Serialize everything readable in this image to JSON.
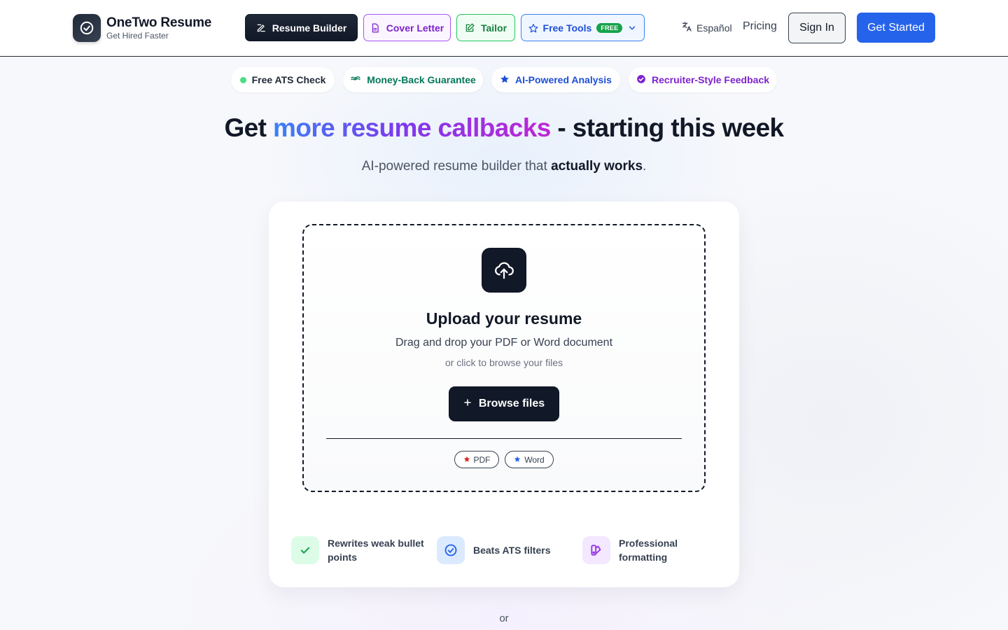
{
  "header": {
    "brand": "OneTwo Resume",
    "tagline": "Get Hired Faster",
    "nav": {
      "resume_builder": "Resume Builder",
      "cover_letter": "Cover Letter",
      "tailor": "Tailor",
      "free_tools": "Free Tools",
      "free_badge": "FREE"
    },
    "language": "Español",
    "pricing": "Pricing",
    "sign_in": "Sign In",
    "get_started": "Get Started"
  },
  "trust_pills": [
    {
      "label": "Free ATS Check",
      "icon": "green-dot-icon",
      "color": "#1f2937"
    },
    {
      "label": "Money-Back Guarantee",
      "icon": "cash-icon",
      "color": "#047857"
    },
    {
      "label": "AI-Powered Analysis",
      "icon": "star-icon",
      "color": "#1d4ed8"
    },
    {
      "label": "Recruiter-Style Feedback",
      "icon": "check-badge-icon",
      "color": "#7e22ce"
    }
  ],
  "hero": {
    "title_prefix": "Get ",
    "title_highlight": "more resume callbacks",
    "title_suffix": " - starting this week",
    "subtitle_prefix": "AI-powered resume builder that ",
    "subtitle_bold": "actually works",
    "subtitle_suffix": "."
  },
  "upload": {
    "title": "Upload your resume",
    "description": "Drag and drop your PDF or Word document",
    "hint": "or click to browse your files",
    "browse_label": "Browse files",
    "formats": [
      {
        "label": "PDF",
        "icon": "red-star-icon"
      },
      {
        "label": "Word",
        "icon": "blue-star-icon"
      }
    ]
  },
  "features": [
    {
      "label": "Rewrites weak bullet points",
      "icon": "check-icon"
    },
    {
      "label": "Beats ATS filters",
      "icon": "check-circle-icon"
    },
    {
      "label": "Professional formatting",
      "icon": "palette-icon"
    }
  ],
  "or_text": "or",
  "colors": {
    "primary_dark": "#111827",
    "accent_blue": "#2563eb",
    "cover_purple": "#7e22ce",
    "tailor_green": "#15803d"
  }
}
